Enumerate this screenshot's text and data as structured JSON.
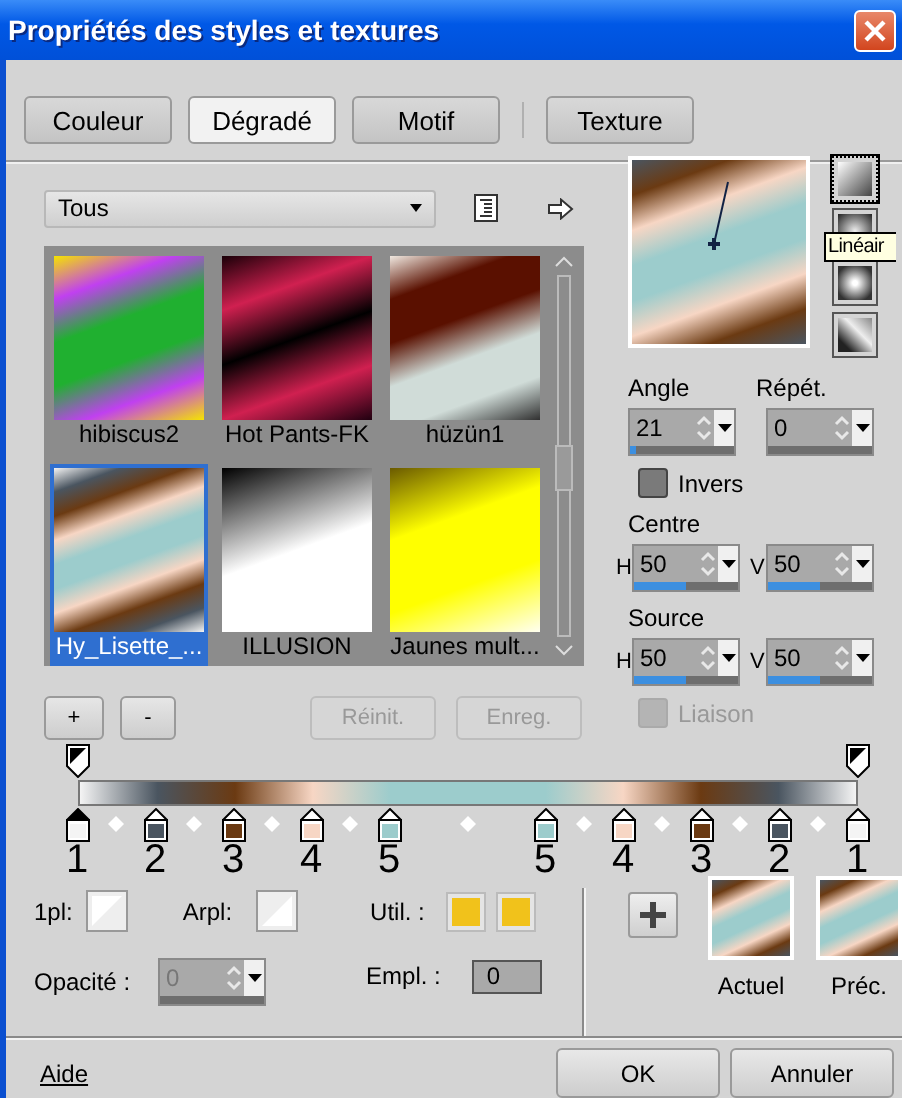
{
  "window": {
    "title": "Propriétés des styles et textures"
  },
  "tabs": [
    {
      "label": "Couleur",
      "selected": false
    },
    {
      "label": "Dégradé",
      "selected": true
    },
    {
      "label": "Motif",
      "selected": false
    },
    {
      "label": "Texture",
      "selected": false
    }
  ],
  "library": {
    "category": "Tous",
    "presets": [
      {
        "name": "hibiscus2",
        "selected": false
      },
      {
        "name": "Hot Pants-FK",
        "selected": false
      },
      {
        "name": "hüzün1",
        "selected": false
      },
      {
        "name": "Hy_Lisette_...",
        "selected": true
      },
      {
        "name": "ILLUSION",
        "selected": false
      },
      {
        "name": "Jaunes mult...",
        "selected": false
      }
    ]
  },
  "library_buttons": [
    {
      "label": "+",
      "disabled": false
    },
    {
      "label": "-",
      "disabled": false
    },
    {
      "label": "Réinit.",
      "disabled": true
    },
    {
      "label": "Enreg.",
      "disabled": true
    }
  ],
  "gradient_types": [
    {
      "kind": "linear",
      "selected": true
    },
    {
      "kind": "rectangular",
      "selected": false
    },
    {
      "kind": "radial",
      "selected": false
    },
    {
      "kind": "corner",
      "selected": false
    }
  ],
  "tooltip": "Linéair",
  "angle": {
    "label": "Angle",
    "value": "21",
    "level": 0.06
  },
  "repeat": {
    "label": "Répét.",
    "value": "0"
  },
  "invert": {
    "label": "Invers",
    "checked": false
  },
  "centre": {
    "label": "Centre",
    "h": {
      "label": "H",
      "value": "50",
      "level": 0.5
    },
    "v": {
      "label": "V",
      "value": "50",
      "level": 0.5
    }
  },
  "source": {
    "label": "Source",
    "h": {
      "label": "H",
      "value": "50",
      "level": 0.5
    },
    "v": {
      "label": "V",
      "value": "50",
      "level": 0.5
    }
  },
  "link": {
    "label": "Liaison",
    "checked": false,
    "disabled": true
  },
  "color_stops": [
    {
      "number": "1",
      "color": "#f4f4f4",
      "selected": true
    },
    {
      "number": "2",
      "color": "#4a5560",
      "selected": false
    },
    {
      "number": "3",
      "color": "#6b3a12",
      "selected": false
    },
    {
      "number": "4",
      "color": "#f7d6c4",
      "selected": false
    },
    {
      "number": "5",
      "color": "#9ccccc",
      "selected": false
    },
    {
      "number": "5",
      "color": "#9ccccc",
      "selected": false
    },
    {
      "number": "4",
      "color": "#f7d6c4",
      "selected": false
    },
    {
      "number": "3",
      "color": "#6b3a12",
      "selected": false
    },
    {
      "number": "2",
      "color": "#4a5560",
      "selected": false
    },
    {
      "number": "1",
      "color": "#f4f4f4",
      "selected": false
    }
  ],
  "stop_fields": {
    "foreground_label": "1pl:",
    "background_label": "Arpl:",
    "user_label": "Util. :",
    "user_colors": [
      {
        "color": "#f1c21b"
      },
      {
        "color": "#f1c21b"
      }
    ],
    "opacity": {
      "label": "Opacité :",
      "value": "0",
      "disabled": true
    },
    "location": {
      "label": "Empl. :",
      "value": "0"
    }
  },
  "comparison": {
    "current": "Actuel",
    "previous": "Préc."
  },
  "help": "Aide",
  "buttons": [
    {
      "label": "OK"
    },
    {
      "label": "Annuler"
    }
  ]
}
